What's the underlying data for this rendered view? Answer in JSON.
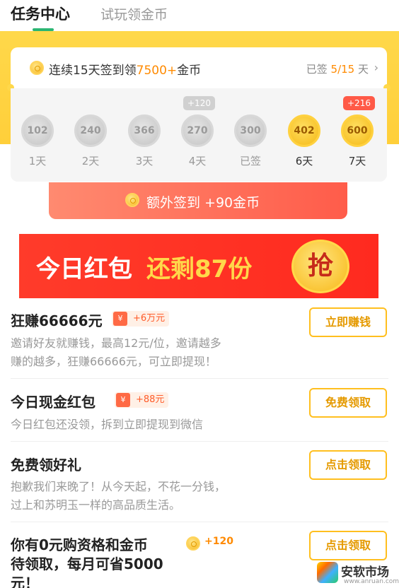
{
  "tabs": {
    "active": "任务中心",
    "inactive": "试玩领金币"
  },
  "checkin": {
    "title_prefix": "连续15天签到领",
    "title_amount": "7500+",
    "title_suffix": "金币",
    "status_prefix": "已签 ",
    "status_progress": "5/15",
    "status_suffix": " 天",
    "days": [
      {
        "coins": "102",
        "label": "1天",
        "state": "signed"
      },
      {
        "coins": "240",
        "label": "2天",
        "state": "signed"
      },
      {
        "coins": "366",
        "label": "3天",
        "state": "signed"
      },
      {
        "coins": "270",
        "label": "4天",
        "state": "signed",
        "bonus": "+120"
      },
      {
        "coins": "300",
        "label": "已签",
        "state": "signed"
      },
      {
        "coins": "402",
        "label": "6天",
        "state": "upcoming"
      },
      {
        "coins": "600",
        "label": "7天",
        "state": "upcoming",
        "bonus": "+216"
      }
    ],
    "extra_label": "额外签到 +90金币"
  },
  "banner": {
    "text1": "今日红包",
    "text2": "还剩87份",
    "grab": "抢"
  },
  "tasks": [
    {
      "title": "狂赚66666元",
      "badge": "+6万元",
      "badge_icon": "¥",
      "desc1": "邀请好友就赚钱，最高12元/位，邀请越多",
      "desc2": "赚的越多，狂赚66666元，可立即提现！",
      "button": "立即赚钱"
    },
    {
      "title": "今日现金红包",
      "badge": "+88元",
      "badge_icon": "¥",
      "desc1": "今日红包还没领，拆到立即提现到微信",
      "button": "免费领取"
    },
    {
      "title": "免费领好礼",
      "desc1": "抱歉我们来晚了！从今天起，不花一分钱，",
      "desc2": "过上和苏明玉一样的高品质生活。",
      "button": "点击领取"
    },
    {
      "title1": "你有0元购资格和金币",
      "title2": "待领取，每月可省5000",
      "title3": "元！",
      "badge": "+120",
      "button": "点击领取"
    }
  ],
  "watermark": {
    "title": "安软市场",
    "url": "www.anruan.com"
  },
  "colors": {
    "accent_green": "#2bb673",
    "gold": "#ffbf1f",
    "red": "#ff3b2a",
    "orange_text": "#ff8a00"
  }
}
